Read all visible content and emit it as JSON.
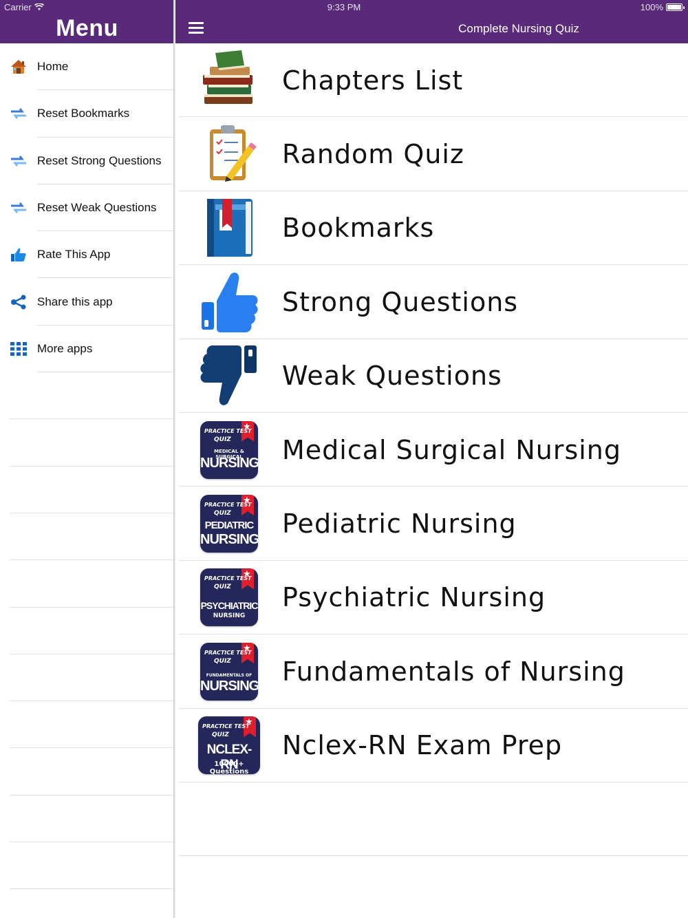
{
  "status_bar": {
    "carrier": "Carrier",
    "time": "9:33 PM",
    "battery": "100%"
  },
  "sidebar": {
    "title": "Menu",
    "items": [
      {
        "label": "Home",
        "icon": "home-icon"
      },
      {
        "label": "Reset Bookmarks",
        "icon": "refresh-arrows-icon"
      },
      {
        "label": "Reset Strong Questions",
        "icon": "refresh-arrows-icon"
      },
      {
        "label": "Reset Weak Questions",
        "icon": "refresh-arrows-icon"
      },
      {
        "label": "Rate This App",
        "icon": "thumbs-up-icon"
      },
      {
        "label": "Share this app",
        "icon": "share-icon"
      },
      {
        "label": "More apps",
        "icon": "grid-icon"
      }
    ]
  },
  "header": {
    "title": "Complete Nursing Quiz",
    "menu_icon": "hamburger-icon"
  },
  "main": {
    "items": [
      {
        "label": "Chapters List",
        "icon": "books-icon"
      },
      {
        "label": "Random Quiz",
        "icon": "clipboard-pencil-icon"
      },
      {
        "label": "Bookmarks",
        "icon": "bookmark-book-icon"
      },
      {
        "label": "Strong Questions",
        "icon": "thumbs-up-icon"
      },
      {
        "label": "Weak Questions",
        "icon": "thumbs-down-icon"
      },
      {
        "label": "Medical Surgical Nursing",
        "icon": "medical-surgical-nursing-badge-icon",
        "badge": [
          "PRACTICE TEST",
          "QUIZ",
          "MEDICAL & SURGICAL",
          "NURSING"
        ]
      },
      {
        "label": "Pediatric Nursing",
        "icon": "pediatric-nursing-badge-icon",
        "badge": [
          "PRACTICE TEST",
          "QUIZ",
          "PEDIATRIC",
          "NURSING"
        ]
      },
      {
        "label": "Psychiatric Nursing",
        "icon": "psychiatric-nursing-badge-icon",
        "badge": [
          "PRACTICE TEST",
          "QUIZ",
          "PSYCHIATRIC",
          "NURSING"
        ]
      },
      {
        "label": "Fundamentals of Nursing",
        "icon": "fundamentals-nursing-badge-icon",
        "badge": [
          "PRACTICE TEST",
          "QUIZ",
          "FUNDAMENTALS OF",
          "NURSING"
        ]
      },
      {
        "label": "Nclex-RN Exam Prep",
        "icon": "nclex-rn-badge-icon",
        "badge": [
          "PRACTICE TEST",
          "QUIZ",
          "NCLEX-RN",
          "10000+ Questions"
        ]
      }
    ]
  },
  "colors": {
    "header_bg": "#5a2a7a",
    "icon_blue": "#1e88e5",
    "thumbs_down": "#123e73",
    "badge_bg": "#25275a",
    "badge_ribbon": "#e01e2e"
  }
}
